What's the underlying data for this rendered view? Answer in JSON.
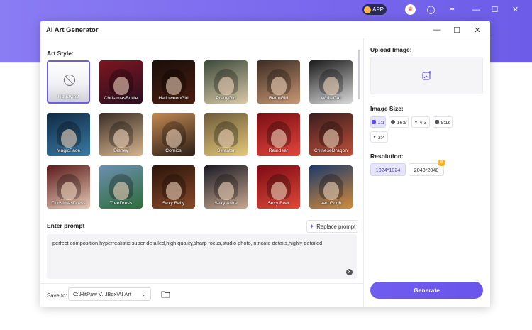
{
  "background": {
    "app_label": "APP",
    "badge_label": "VIP"
  },
  "dialog": {
    "title": "AI Art Generator",
    "art_style_label": "Art Style:",
    "styles": [
      {
        "name": "No Style2",
        "palette": [
          "#ffffff",
          "#d0d0d8"
        ],
        "selected": true
      },
      {
        "name": "ChristmasBottle",
        "palette": [
          "#7d1520",
          "#2a1020"
        ]
      },
      {
        "name": "HalloweenGirl",
        "palette": [
          "#1a0f0a",
          "#4a1d10"
        ]
      },
      {
        "name": "PrettyGirl",
        "palette": [
          "#3c4a3a",
          "#d9c8a8"
        ]
      },
      {
        "name": "RetroGirl",
        "palette": [
          "#3a2b22",
          "#c99775"
        ]
      },
      {
        "name": "WhiteCat",
        "palette": [
          "#1a1a1a",
          "#d8d8d8"
        ]
      },
      {
        "name": "MagicFace",
        "palette": [
          "#0f2a44",
          "#3a7aa5"
        ]
      },
      {
        "name": "Disney",
        "palette": [
          "#3b2e26",
          "#d6b48e"
        ]
      },
      {
        "name": "Comics",
        "palette": [
          "#c28a52",
          "#2c1e18"
        ]
      },
      {
        "name": "Sweater",
        "palette": [
          "#6d5a3a",
          "#e4c87a"
        ]
      },
      {
        "name": "Reindeer",
        "palette": [
          "#7a0e12",
          "#e3463d"
        ]
      },
      {
        "name": "ChineseDragon",
        "palette": [
          "#3a1d1d",
          "#c0503a"
        ]
      },
      {
        "name": "ChristmasDress",
        "palette": [
          "#5a1a1a",
          "#e7c9b6"
        ]
      },
      {
        "name": "TreeDress",
        "palette": [
          "#6c8fb0",
          "#2f6d3c"
        ]
      },
      {
        "name": "Sexy Belly",
        "palette": [
          "#2a140a",
          "#8a4a2a"
        ]
      },
      {
        "name": "Sexy Attire",
        "palette": [
          "#1a1a24",
          "#c9a88f"
        ]
      },
      {
        "name": "Sexy Feet",
        "palette": [
          "#7c0a14",
          "#e04a3a"
        ]
      },
      {
        "name": "Van Gogh",
        "palette": [
          "#1d3a6a",
          "#d28a3a"
        ]
      }
    ],
    "prompt": {
      "label": "Enter prompt",
      "replace_label": "Replace prompt",
      "text": "perfect composition,hyperrealistic,super detailed,high quality,sharp focus,studio photo,intricate details,highly detailed"
    },
    "save": {
      "label": "Save to:",
      "path": "C:\\HitPaw V...lBox\\AI Art"
    },
    "upload": {
      "label": "Upload Image:"
    },
    "image_size": {
      "label": "Image Size:",
      "options": [
        {
          "label": "1:1",
          "active": true
        },
        {
          "label": "16:9"
        },
        {
          "label": "4:3"
        },
        {
          "label": "9:16"
        },
        {
          "label": "3:4"
        }
      ]
    },
    "resolution": {
      "label": "Resolution:",
      "options": [
        {
          "label": "1024*1024",
          "active": true
        },
        {
          "label": "2048*2048",
          "premium": true
        }
      ]
    },
    "generate_label": "Generate"
  }
}
